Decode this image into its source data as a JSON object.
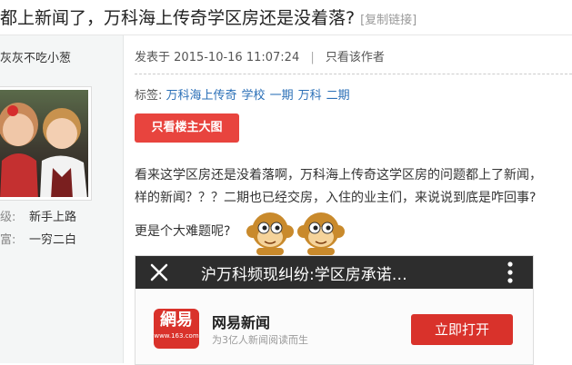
{
  "header": {
    "title": "都上新闻了，万科海上传奇学区房还是没着落?",
    "copy_link": "[复制链接]"
  },
  "author": {
    "name": "灰灰不吃小葱",
    "level_label": "级:",
    "level_value": "新手上路",
    "wealth_label": "富:",
    "wealth_value": "一穷二白"
  },
  "post": {
    "posted_label": "发表于",
    "posted_time": "2015-10-16 11:07:24",
    "author_only": "只看该作者",
    "tags_label": "标签:",
    "tags": [
      "万科海上传奇",
      "学校",
      "一期",
      "万科",
      "二期"
    ],
    "op_only_button": "只看楼主大图",
    "para1": "看来这学区房还是没着落啊，万科海上传奇这学区房的问题都上了新闻，",
    "para2": "样的新闻？？？二期也已经交房，入住的业主们，来说说到底是咋回事?",
    "para3": "更是个大难题呢?"
  },
  "embed": {
    "title": "沪万科频现纠纷:学区房承诺…",
    "app_logo": "網易",
    "app_logo_small": "www.163.com",
    "app_name": "网易新闻",
    "app_sub": "为3亿人新闻阅读而生",
    "open_button": "立即打开"
  },
  "colors": {
    "accent_red": "#e8443e",
    "link_blue": "#2a6fb7",
    "embed_bar": "#2d2d2d"
  }
}
